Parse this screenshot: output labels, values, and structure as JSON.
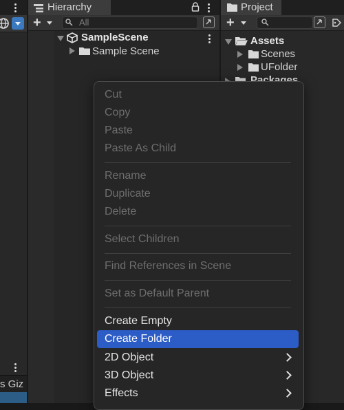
{
  "hierarchy": {
    "tab_title": "Hierarchy",
    "search_placeholder": "All",
    "scene_root": "SampleScene",
    "scene_child": "Sample Scene"
  },
  "project": {
    "tab_title": "Project",
    "assets_label": "Assets",
    "scenes_label": "Scenes",
    "ufolder_label": "UFolder",
    "packages_label": "Packages"
  },
  "left_panel": {
    "tab_labels": "s Giz"
  },
  "context_menu": {
    "cut": "Cut",
    "copy": "Copy",
    "paste": "Paste",
    "paste_as_child": "Paste As Child",
    "rename": "Rename",
    "duplicate": "Duplicate",
    "delete": "Delete",
    "select_children": "Select Children",
    "find_references": "Find References in Scene",
    "set_default_parent": "Set as Default Parent",
    "create_empty": "Create Empty",
    "create_folder": "Create Folder",
    "object_2d": "2D Object",
    "object_3d": "3D Object",
    "effects": "Effects"
  },
  "colors": {
    "highlight": "#2c5cc5",
    "panel_bg": "#282828",
    "menu_bg": "#262626",
    "disabled_text": "#6e6e6e",
    "enabled_text": "#e6e6e6"
  }
}
